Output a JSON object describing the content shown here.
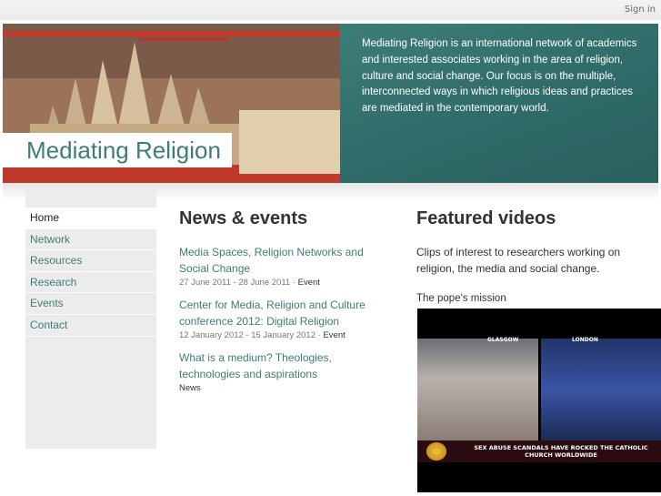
{
  "header": {
    "signin_label": "Sign in"
  },
  "banner": {
    "site_title": "Mediating Religion",
    "description": "Mediating Religion is an international network of academics and interested associates working in the area of religion, culture and social change. Our focus is on the multiple, interconnected ways in which religious ideas and practices are mediated in the contemporary world."
  },
  "nav": {
    "items": [
      {
        "label": "Home",
        "active": true
      },
      {
        "label": "Network"
      },
      {
        "label": "Resources"
      },
      {
        "label": "Research"
      },
      {
        "label": "Events"
      },
      {
        "label": "Contact"
      }
    ]
  },
  "news": {
    "title": "News & events",
    "items": [
      {
        "title": "Media Spaces, Religion Networks and Social Change",
        "date": "27 June 2011 - 28 June 2011 · ",
        "type": "Event"
      },
      {
        "title": "Center for Media, Religion and Culture conference 2012: Digital Religion",
        "date": "12 January 2012 - 15 January 2012 · ",
        "type": "Event"
      },
      {
        "title": "What is a medium? Theologies, technologies and aspirations",
        "date": "",
        "type": "News"
      }
    ]
  },
  "videos": {
    "title": "Featured videos",
    "description": "Clips of interest to researchers working on religion, the media and social change.",
    "caption": "The pope's mission",
    "frame": {
      "location_left": "GLASGOW",
      "location_right": "LONDON",
      "headline": "SEX ABUSE SCANDALS HAVE ROCKED THE CATHOLIC CHURCH WORLDWIDE"
    }
  },
  "colors": {
    "accent": "#3f7c76",
    "banner_panel": "#2f6b68",
    "sidebar": "#ececec"
  }
}
